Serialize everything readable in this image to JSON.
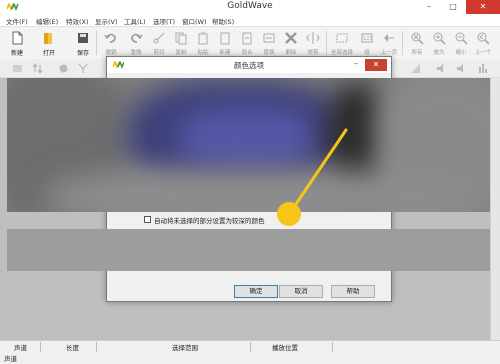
{
  "app": {
    "title": "GoldWave"
  },
  "window_controls": {
    "minimize": "–",
    "maximize": "□",
    "close": "✕"
  },
  "menu": [
    {
      "label": "文件(F)"
    },
    {
      "label": "编辑(E)"
    },
    {
      "label": "特效(X)"
    },
    {
      "label": "显示(V)"
    },
    {
      "label": "工具(L)"
    },
    {
      "label": "选项(T)"
    },
    {
      "label": "窗口(W)"
    },
    {
      "label": "帮助(S)"
    }
  ],
  "toolbar": {
    "new": "新建",
    "open": "打开",
    "save": "保存",
    "undo": "撤销",
    "redo": "重做",
    "cut": "剪切",
    "copy": "复制",
    "paste": "粘贴",
    "new2": "新建",
    "mix": "混合",
    "replace": "替换",
    "delete": "删除",
    "trim": "修剪",
    "select_all": "全部选择",
    "set": "组",
    "prev": "上一页",
    "all": "所有",
    "zoom_in": "放大",
    "zoom_out": "缩小",
    "prev2": "上一个"
  },
  "dialog": {
    "title": "颜色选项",
    "minimize": "–",
    "close": "✕",
    "checkbox_label": "自动将未选择的部分设置为较深的颜色",
    "checkbox_checked": false,
    "ok": "确定",
    "cancel": "取消",
    "help": "帮助"
  },
  "statusbar": {
    "columns": [
      "声道",
      "长度",
      "选择范围",
      "播放位置"
    ],
    "row2": "声道"
  },
  "colors": {
    "accent_pointer": "#f5c518",
    "close_red": "#d13b2f",
    "logo_yellow": "#e9b510",
    "logo_green": "#3e9a3a"
  }
}
